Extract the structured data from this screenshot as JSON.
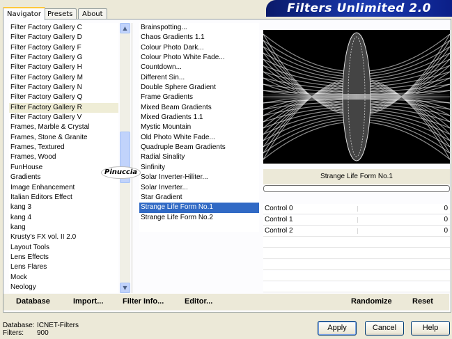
{
  "window": {
    "banner_title": "Filters Unlimited 2.0"
  },
  "tabs": [
    {
      "label": "Navigator",
      "active": true
    },
    {
      "label": "Presets",
      "active": false
    },
    {
      "label": "About",
      "active": false
    }
  ],
  "categories": {
    "items": [
      "Filter Factory Gallery C",
      "Filter Factory Gallery D",
      "Filter Factory Gallery F",
      "Filter Factory Gallery G",
      "Filter Factory Gallery H",
      "Filter Factory Gallery M",
      "Filter Factory Gallery N",
      "Filter Factory Gallery Q",
      "Filter Factory Gallery R",
      "Filter Factory Gallery V",
      "Frames, Marble & Crystal",
      "Frames, Stone & Granite",
      "Frames, Textured",
      "Frames, Wood",
      "FunHouse",
      "Gradients",
      "Image Enhancement",
      "Italian Editors Effect",
      "kang 3",
      "kang 4",
      "kang",
      "Krusty's FX vol. II 2.0",
      "Layout Tools",
      "Lens Effects",
      "Lens Flares",
      "Mock",
      "Neology"
    ],
    "highlighted_index": 8
  },
  "filters": {
    "items": [
      "Brainspotting...",
      "Chaos Gradients 1.1",
      "Colour Photo Dark...",
      "Colour Photo White Fade...",
      "Countdown...",
      "Different Sin...",
      "Double Sphere Gradient",
      "Frame Gradients",
      "Mixed Beam Gradients",
      "Mixed Gradients 1.1",
      "Mystic Mountain",
      "Old Photo White Fade...",
      "Quadruple Beam Gradients",
      "Radial Sinality",
      "Sinfinity",
      "Solar Inverter-Hiliter...",
      "Solar Inverter...",
      "Star Gradient",
      "Strange Life Form No.1",
      "Strange Life Form No.2"
    ],
    "selected_index": 18
  },
  "watermark": "Pinuccia",
  "preview": {
    "filter_name": "Strange Life Form No.1",
    "progress": 0
  },
  "controls": [
    {
      "label": "Control 0",
      "value": "0"
    },
    {
      "label": "Control 1",
      "value": "0"
    },
    {
      "label": "Control 2",
      "value": "0"
    }
  ],
  "linkbar": {
    "database": "Database",
    "import": "Import...",
    "filter_info": "Filter Info...",
    "editor": "Editor...",
    "randomize": "Randomize",
    "reset": "Reset"
  },
  "footer": {
    "database_label": "Database:",
    "database_value": "ICNET-Filters",
    "filters_label": "Filters:",
    "filters_value": "900",
    "apply": "Apply",
    "cancel": "Cancel",
    "help": "Help"
  },
  "colors": {
    "selection": "#316ac5",
    "banner": "#1b3bb0",
    "dialog_bg": "#ece9d8"
  }
}
